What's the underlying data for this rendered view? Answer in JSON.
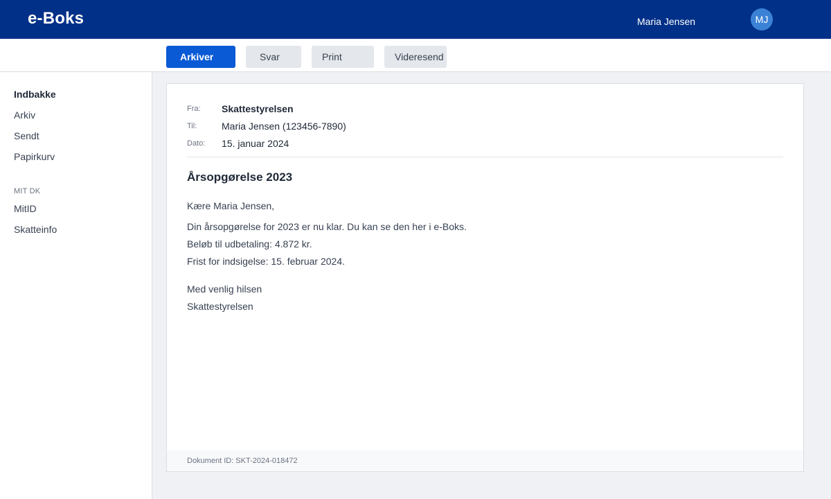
{
  "app": {
    "title": "e-Boks"
  },
  "user": {
    "name": "Maria Jensen",
    "initials": "MJ"
  },
  "toolbar": {
    "archive_label": "Arkiver",
    "reply_label": "Svar",
    "print_label": "Print",
    "forward_label": "Videresend"
  },
  "sidebar": {
    "items": [
      {
        "label": "Indbakke"
      },
      {
        "label": "Arkiv"
      },
      {
        "label": "Sendt"
      },
      {
        "label": "Papirkurv"
      }
    ],
    "section_title": "MIT DK",
    "section_items": [
      {
        "label": "MitID"
      },
      {
        "label": "Skatteinfo"
      }
    ]
  },
  "message": {
    "from_label": "Fra:",
    "from_value": "Skattestyrelsen",
    "to_label": "Til:",
    "to_value": "Maria Jensen (123456-7890)",
    "date_label": "Dato:",
    "date_value": "15. januar 2024",
    "subject": "Årsopgørelse 2023",
    "greeting": "Kære Maria Jensen,",
    "body": [
      "Din årsopgørelse for 2023 er nu klar. Du kan se den her i e-Boks.",
      "Beløb til udbetaling: 4.872 kr.",
      "Frist for indsigelse: 15. februar 2024."
    ],
    "closing": "Med venlig hilsen",
    "signature": "Skattestyrelsen",
    "document_id": "Dokument ID: SKT-2024-018472"
  },
  "colors": {
    "header": "#003087",
    "primary_button": "#0a5ad6",
    "avatar": "#3b82d6"
  }
}
